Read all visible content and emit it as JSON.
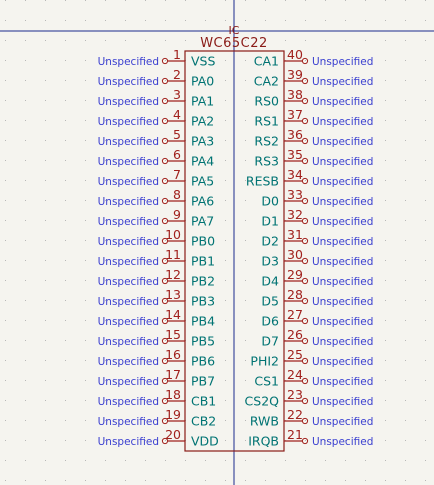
{
  "component": {
    "reference": "IC",
    "value": "WC65C22"
  },
  "left_pins": [
    {
      "num": "1",
      "name": "VSS",
      "net": "Unspecified"
    },
    {
      "num": "2",
      "name": "PA0",
      "net": "Unspecified"
    },
    {
      "num": "3",
      "name": "PA1",
      "net": "Unspecified"
    },
    {
      "num": "4",
      "name": "PA2",
      "net": "Unspecified"
    },
    {
      "num": "5",
      "name": "PA3",
      "net": "Unspecified"
    },
    {
      "num": "6",
      "name": "PA4",
      "net": "Unspecified"
    },
    {
      "num": "7",
      "name": "PA5",
      "net": "Unspecified"
    },
    {
      "num": "8",
      "name": "PA6",
      "net": "Unspecified"
    },
    {
      "num": "9",
      "name": "PA7",
      "net": "Unspecified"
    },
    {
      "num": "10",
      "name": "PB0",
      "net": "Unspecified"
    },
    {
      "num": "11",
      "name": "PB1",
      "net": "Unspecified"
    },
    {
      "num": "12",
      "name": "PB2",
      "net": "Unspecified"
    },
    {
      "num": "13",
      "name": "PB3",
      "net": "Unspecified"
    },
    {
      "num": "14",
      "name": "PB4",
      "net": "Unspecified"
    },
    {
      "num": "15",
      "name": "PB5",
      "net": "Unspecified"
    },
    {
      "num": "16",
      "name": "PB6",
      "net": "Unspecified"
    },
    {
      "num": "17",
      "name": "PB7",
      "net": "Unspecified"
    },
    {
      "num": "18",
      "name": "CB1",
      "net": "Unspecified"
    },
    {
      "num": "19",
      "name": "CB2",
      "net": "Unspecified"
    },
    {
      "num": "20",
      "name": "VDD",
      "net": "Unspecified"
    }
  ],
  "right_pins": [
    {
      "num": "40",
      "name": "CA1",
      "net": "Unspecified"
    },
    {
      "num": "39",
      "name": "CA2",
      "net": "Unspecified"
    },
    {
      "num": "38",
      "name": "RS0",
      "net": "Unspecified"
    },
    {
      "num": "37",
      "name": "RS1",
      "net": "Unspecified"
    },
    {
      "num": "36",
      "name": "RS2",
      "net": "Unspecified"
    },
    {
      "num": "35",
      "name": "RS3",
      "net": "Unspecified"
    },
    {
      "num": "34",
      "name": "RESB",
      "net": "Unspecified"
    },
    {
      "num": "33",
      "name": "D0",
      "net": "Unspecified"
    },
    {
      "num": "32",
      "name": "D1",
      "net": "Unspecified"
    },
    {
      "num": "31",
      "name": "D2",
      "net": "Unspecified"
    },
    {
      "num": "30",
      "name": "D3",
      "net": "Unspecified"
    },
    {
      "num": "29",
      "name": "D4",
      "net": "Unspecified"
    },
    {
      "num": "28",
      "name": "D5",
      "net": "Unspecified"
    },
    {
      "num": "27",
      "name": "D6",
      "net": "Unspecified"
    },
    {
      "num": "26",
      "name": "D7",
      "net": "Unspecified"
    },
    {
      "num": "25",
      "name": "PHI2",
      "net": "Unspecified"
    },
    {
      "num": "24",
      "name": "CS1",
      "net": "Unspecified"
    },
    {
      "num": "23",
      "name": "CS2Q",
      "net": "Unspecified"
    },
    {
      "num": "22",
      "name": "RWB",
      "net": "Unspecified"
    },
    {
      "num": "21",
      "name": "IRQB",
      "net": "Unspecified"
    }
  ],
  "colors": {
    "background": "#f5f4ef",
    "grid_dot": "#b8b8b8",
    "body_outline": "#8a1b17",
    "pin_line": "#a1211d",
    "pin_name": "#007373",
    "net_label": "#3a3fd0",
    "crosshair": "#1a2a8c"
  }
}
